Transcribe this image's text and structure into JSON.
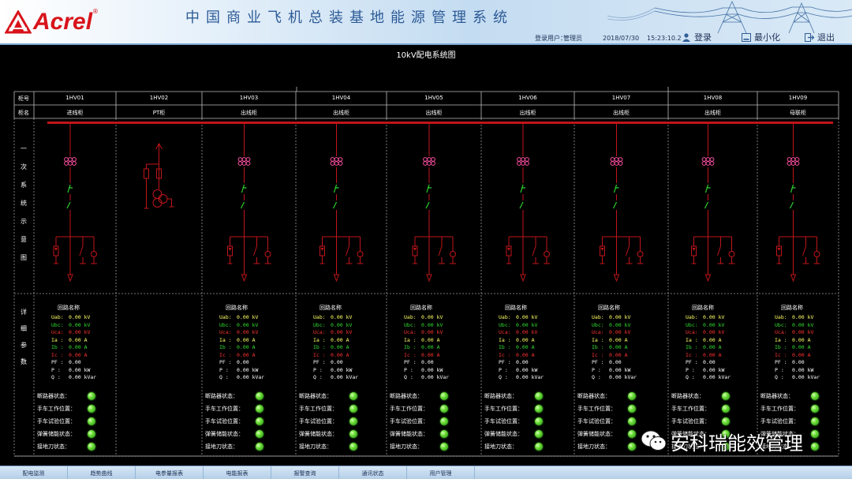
{
  "header": {
    "logo_text": "Acrel",
    "logo_reg": "®",
    "title": "中国商业飞机总装基地能源管理系统",
    "login_user_label": "登录用户：",
    "login_user": "管理员",
    "date": "2018/07/30",
    "time": "15:23:10.2",
    "login_button": "登录",
    "minimize_button": "最小化",
    "exit_button": "退出"
  },
  "diagram": {
    "title": "10kV配电系统图",
    "row_labels": {
      "code": "柜号",
      "name": "柜名"
    },
    "primary_label": [
      "一",
      "次",
      "系",
      "统",
      "示",
      "意",
      "图"
    ],
    "detail_label": [
      "详",
      "细",
      "参",
      "数"
    ]
  },
  "cabinets": [
    {
      "code": "1HV01",
      "name": "进线柜"
    },
    {
      "code": "1HV02",
      "name": "PT柜"
    },
    {
      "code": "1HV03",
      "name": "出线柜"
    },
    {
      "code": "1HV04",
      "name": "出线柜"
    },
    {
      "code": "1HV05",
      "name": "出线柜"
    },
    {
      "code": "1HV06",
      "name": "出线柜"
    },
    {
      "code": "1HV07",
      "name": "出线柜"
    },
    {
      "code": "1HV08",
      "name": "出线柜"
    },
    {
      "code": "1HV09",
      "name": "母联柜"
    }
  ],
  "params": {
    "title": "回路名称",
    "rows": [
      {
        "label": "Uab:",
        "value": "0.00 kV",
        "color": "#ffff66"
      },
      {
        "label": "Ubc:",
        "value": "0.00 kV",
        "color": "#33dd33"
      },
      {
        "label": "Uca:",
        "value": "0.00 kV",
        "color": "#ff3333"
      },
      {
        "label": "Ia :",
        "value": "0.00 A",
        "color": "#ffff66"
      },
      {
        "label": "Ib :",
        "value": "0.00 A",
        "color": "#33dd33"
      },
      {
        "label": "Ic :",
        "value": "0.00 A",
        "color": "#ff3333"
      },
      {
        "label": "PF :",
        "value": "0.00",
        "color": "#ffffff"
      },
      {
        "label": "P  :",
        "value": "0.00 kW",
        "color": "#ffffff"
      },
      {
        "label": "Q  :",
        "value": "0.00 kVar",
        "color": "#ffffff"
      }
    ]
  },
  "states": [
    "断路器状态：",
    "手车工作位置：",
    "手车试验位置：",
    "弹簧储能状态：",
    "接地刀状态："
  ],
  "watermark": "安科瑞能效管理",
  "bottom_tabs": [
    "配电监测",
    "趋势曲线",
    "电参量报表",
    "电能报表",
    "报警查询",
    "通讯状态",
    "用户管理"
  ],
  "colors": {
    "busbar": "#c0151a",
    "line": "#c0151a",
    "switch": "#2fd02f",
    "breaker": "#ff4fa0",
    "grid": "#9a9a9a",
    "led": "#5fdc2c"
  }
}
